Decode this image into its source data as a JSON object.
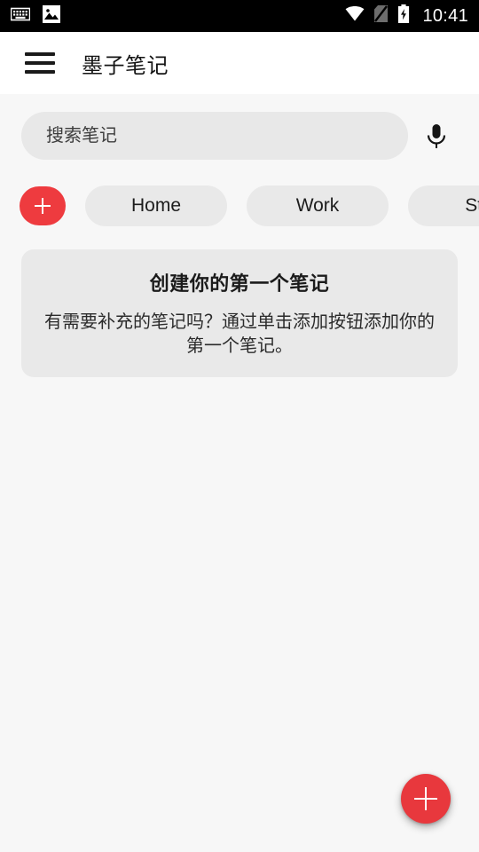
{
  "status_bar": {
    "time": "10:41",
    "left_icons": [
      "keyboard-icon",
      "image-icon"
    ],
    "right_icons": [
      "wifi-icon",
      "no-sim-icon",
      "battery-charging-icon"
    ],
    "background_color": "#000000",
    "foreground_color": "#ffffff"
  },
  "app_bar": {
    "menu_icon": "hamburger-menu-icon",
    "title": "墨子笔记",
    "background_color": "#ffffff"
  },
  "search": {
    "placeholder": "搜索笔记",
    "value": "",
    "voice_icon": "microphone-icon"
  },
  "categories": {
    "add_label": "+",
    "chips": [
      {
        "label": "Home"
      },
      {
        "label": "Work"
      },
      {
        "label": "Stu"
      }
    ]
  },
  "empty_state": {
    "title": "创建你的第一个笔记",
    "body": "有需要补充的笔记吗？通过单击添加按钮添加你的第一个笔记。"
  },
  "fab": {
    "icon": "plus-icon",
    "color": "#e8383d"
  },
  "theme": {
    "accent": "#ee3b3f",
    "page_background": "#f7f7f7",
    "surface": "#e9e9e9",
    "text_primary": "#1a1a1a"
  }
}
